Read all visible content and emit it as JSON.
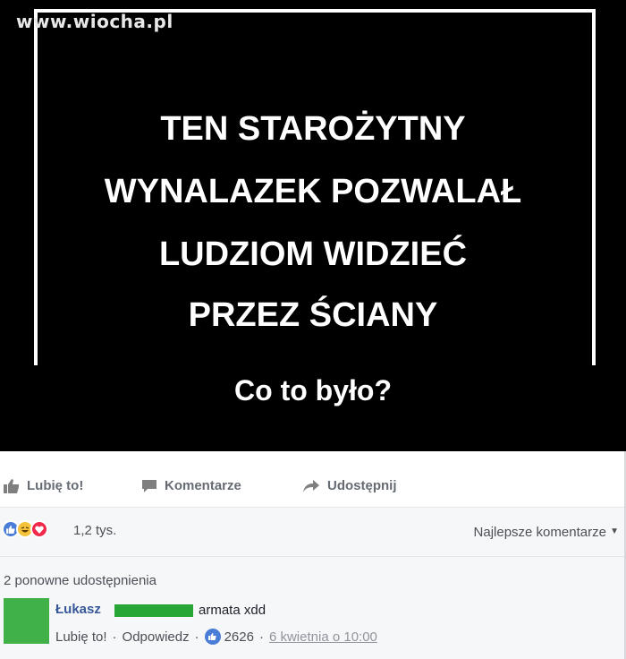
{
  "image": {
    "watermark": "www.wiocha.pl",
    "headline_lines": [
      "TEN STAROŻYTNY",
      "WYNALAZEK POZWALAŁ",
      "LUDZIOM WIDZIEĆ",
      "PRZEZ ŚCIANY"
    ],
    "question": "Co to było?"
  },
  "actions": {
    "like": "Lubię to!",
    "comment": "Komentarze",
    "share": "Udostępnij"
  },
  "reactions": {
    "count": "1,2 tys.",
    "sort": "Najlepsze komentarze"
  },
  "comments": {
    "shares": "2 ponowne udostępnienia",
    "items": [
      {
        "author": "Łukasz",
        "text": "armata xdd",
        "like": "Lubię to!",
        "reply": "Odpowiedz",
        "likes": "2626",
        "date": "6 kwietnia o 10:00"
      }
    ]
  },
  "colors": {
    "link": "#365899",
    "avatar": "#3fb148",
    "like_blue": "#4a7dd6",
    "haha_yellow": "#f5c33b",
    "love_red": "#f0284a"
  }
}
